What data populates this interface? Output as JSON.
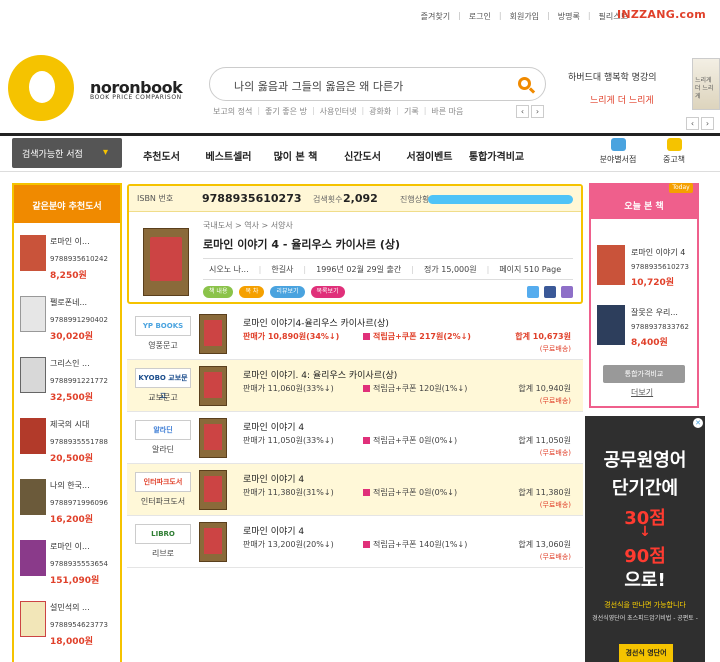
{
  "top_links": [
    "즐겨찾기",
    "로그인",
    "회원가입",
    "방명록",
    "필리스트"
  ],
  "site_brand": "INZZANG.com",
  "logo": {
    "name": "noronbook",
    "sub": "BOOK PRICE COMPARISON"
  },
  "search": {
    "value": "나의 옳음과 그들의 옳음은 왜 다른가"
  },
  "keywords": [
    "보고의 정석",
    "좋기 좋은 방",
    "사용인터넷",
    "광화화",
    "기록",
    "바른 마음"
  ],
  "promo": {
    "line1": "하버드대 행복학 명강의",
    "line2": "느리게 더 느리게",
    "book_text": "느리게 더 느리게"
  },
  "nav": {
    "store_select": "검색가능한 서점",
    "items": [
      "추천도서",
      "베스트셀러",
      "많이 본 책",
      "신간도서",
      "서점이벤트",
      "통합가격비교"
    ],
    "right": [
      "분야별서점",
      "중고책"
    ]
  },
  "left_panel": {
    "title": "같은분야 추천도서",
    "items": [
      {
        "title": "로마인 이...",
        "isbn": "9788935610242",
        "price": "8,250원"
      },
      {
        "title": "펠로폰네...",
        "isbn": "9788991290402",
        "price": "30,020원"
      },
      {
        "title": "그리스인 ...",
        "isbn": "9788991221772",
        "price": "32,500원"
      },
      {
        "title": "제국의 시대",
        "isbn": "9788935551788",
        "price": "20,500원"
      },
      {
        "title": "나의 한국...",
        "isbn": "9788971996096",
        "price": "16,200원"
      },
      {
        "title": "로마인 이...",
        "isbn": "9788935553654",
        "price": "151,090원"
      },
      {
        "title": "설민석의 ...",
        "isbn": "9788954623773",
        "price": "18,000원"
      }
    ]
  },
  "book": {
    "isbn_label": "ISBN 번호",
    "isbn": "9788935610273",
    "count_label": "검색횟수",
    "count": "2,092",
    "progress_label": "진행상황",
    "path": "국내도서 > 역사 > 서양사",
    "title": "로마인 이야기 4 - 율리우스 카이사르 (상)",
    "author": "시오노 나...",
    "publisher": "한길사",
    "date": "1996년 02월 29일 출간",
    "list_price": "정가 15,000원",
    "pages": "페이지 510 Page",
    "tags": [
      "책 내용",
      "목 차",
      "리뷰보기",
      "목록보기"
    ]
  },
  "offers": [
    {
      "store": "영풍문고",
      "logo_text": "YP BOOKS",
      "title": "로마인 이야기4-율리우스 카이사르(상)",
      "sell": "판매가 10,890원(34%↓)",
      "points": "적립금+쿠폰 217원(2%↓)",
      "total": "합계 10,673원",
      "ship": "(무료배송)"
    },
    {
      "store": "교보문고",
      "logo_text": "KYOBO 교보문고",
      "title": "로마인 이야기. 4: 율리우스 카이사르(상)",
      "sell": "판매가 11,060원(33%↓)",
      "points": "적립금+쿠폰 120원(1%↓)",
      "total": "합계 10,940원",
      "ship": "(무료배송)"
    },
    {
      "store": "알라딘",
      "logo_text": "알라딘",
      "title": "로마인 이야기 4",
      "sell": "판매가 11,050원(33%↓)",
      "points": "적립금+쿠폰 0원(0%↓)",
      "total": "합계 11,050원",
      "ship": "(무료배송)"
    },
    {
      "store": "인터파크도서",
      "logo_text": "인터파크도서",
      "title": "로마인 이야기 4",
      "sell": "판매가 11,380원(31%↓)",
      "points": "적립금+쿠폰 0원(0%↓)",
      "total": "합계 11,380원",
      "ship": "(무료배송)"
    },
    {
      "store": "리브로",
      "logo_text": "LIBRO",
      "title": "로마인 이야기 4",
      "sell": "판매가 13,200원(20%↓)",
      "points": "적립금+쿠폰 140원(1%↓)",
      "total": "합계 13,060원",
      "ship": "(무료배송)"
    }
  ],
  "right_panel": {
    "title": "오늘 본 책",
    "badge": "Today",
    "items": [
      {
        "title": "로마인 이야기 4",
        "isbn": "9788935610273",
        "price": "10,720원"
      },
      {
        "title": "잘못은 우리...",
        "isbn": "9788937833762",
        "price": "8,400원"
      }
    ],
    "compare_button": "통합가격비교",
    "more": "더보기"
  },
  "ad": {
    "lines": [
      "공무원영어",
      "단기간에",
      "30점",
      "↓",
      "90점",
      "으로!"
    ],
    "small1": "경선식을 만나면 가능합니다",
    "small2": "경선식영단어 초스피드암기비법 - 공편토 -",
    "book": "경선식 영단어"
  },
  "colors": {
    "accent": "#f5c300",
    "orange": "#f08a00",
    "red": "#e0402a",
    "pink": "#ef5f8c"
  }
}
